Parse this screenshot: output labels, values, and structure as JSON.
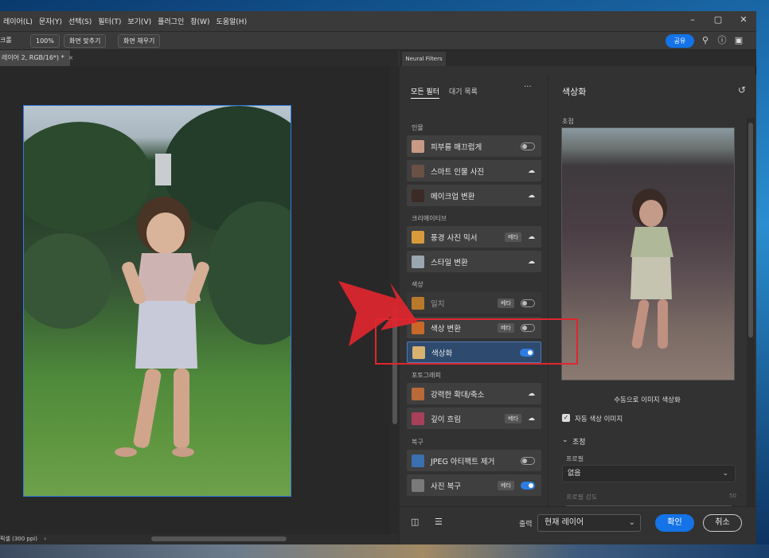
{
  "menubar": {
    "items": [
      "레이어(L)",
      "문자(Y)",
      "선택(S)",
      "필터(T)",
      "보기(V)",
      "플러그인",
      "창(W)",
      "도움말(H)"
    ],
    "window_controls": [
      "–",
      "▢",
      "✕"
    ]
  },
  "options_bar": {
    "tool_label": "크롤",
    "zoom": "100%",
    "fit_screen": "화면 맞추기",
    "fill_screen": "화면 채우기",
    "share": "공유"
  },
  "document": {
    "tab_title": "레이어 2, RGB/16*) *",
    "tab_close": "×",
    "status": "픽셀 (300 ppi)"
  },
  "neural_filters": {
    "panel_tab": "Neural Filters",
    "tabs": {
      "all": "모든 필터",
      "wait": "대기 목록"
    },
    "more": "···",
    "categories": [
      {
        "label": "인물",
        "filters": [
          {
            "name": "피부를 매끄럽게",
            "beta": false,
            "control": "toggle-off",
            "thumb": "#c89a86"
          },
          {
            "name": "스마트 인물 사진",
            "beta": false,
            "control": "cloud",
            "thumb": "#6b5046"
          },
          {
            "name": "메이크업 변환",
            "beta": false,
            "control": "cloud",
            "thumb": "#3c2a26"
          }
        ]
      },
      {
        "label": "크리에이티브",
        "filters": [
          {
            "name": "풍경 사진 믹서",
            "beta": true,
            "control": "cloud",
            "thumb": "#d99a3c"
          },
          {
            "name": "스타일 변환",
            "beta": false,
            "control": "cloud",
            "thumb": "#9aa6b0"
          }
        ]
      },
      {
        "label": "색상",
        "filters": [
          {
            "name": "일치",
            "beta": true,
            "control": "toggle-off",
            "thumb": "#b87a2a",
            "dim": true
          },
          {
            "name": "색상 변환",
            "beta": true,
            "control": "toggle-off",
            "thumb": "#c8692a"
          },
          {
            "name": "색상화",
            "beta": false,
            "control": "toggle-on",
            "thumb": "#d8b070",
            "selected": true
          }
        ]
      },
      {
        "label": "포토그래피",
        "filters": [
          {
            "name": "강력한 확대/축소",
            "beta": false,
            "control": "cloud",
            "thumb": "#b86a3a"
          },
          {
            "name": "깊이 흐림",
            "beta": true,
            "control": "cloud",
            "thumb": "#a8405a"
          }
        ]
      },
      {
        "label": "복구",
        "filters": [
          {
            "name": "JPEG 아티팩트 제거",
            "beta": false,
            "control": "toggle-off",
            "thumb": "#3a6fb0"
          },
          {
            "name": "사진 복구",
            "beta": true,
            "control": "toggle-on",
            "thumb": "#7a7a7a"
          }
        ]
      }
    ],
    "beta_label": "베타"
  },
  "detail": {
    "title": "색상화",
    "preview_label": "초점",
    "preview_caption": "수동으로 이미지 색상화",
    "auto_checkbox": "자동 색상 이미지",
    "adjust_section": "조정",
    "profile_label": "프로필",
    "profile_value": "없음",
    "profile_strength_label": "프로필 강도",
    "profile_strength_value": "50"
  },
  "bottom": {
    "output_label": "출력",
    "output_value": "현재 레이어",
    "confirm": "확인",
    "cancel": "취소"
  },
  "colors": {
    "accent": "#1473e6",
    "annotation_red": "#e0262e",
    "selected_row": "#2e4a6e"
  }
}
